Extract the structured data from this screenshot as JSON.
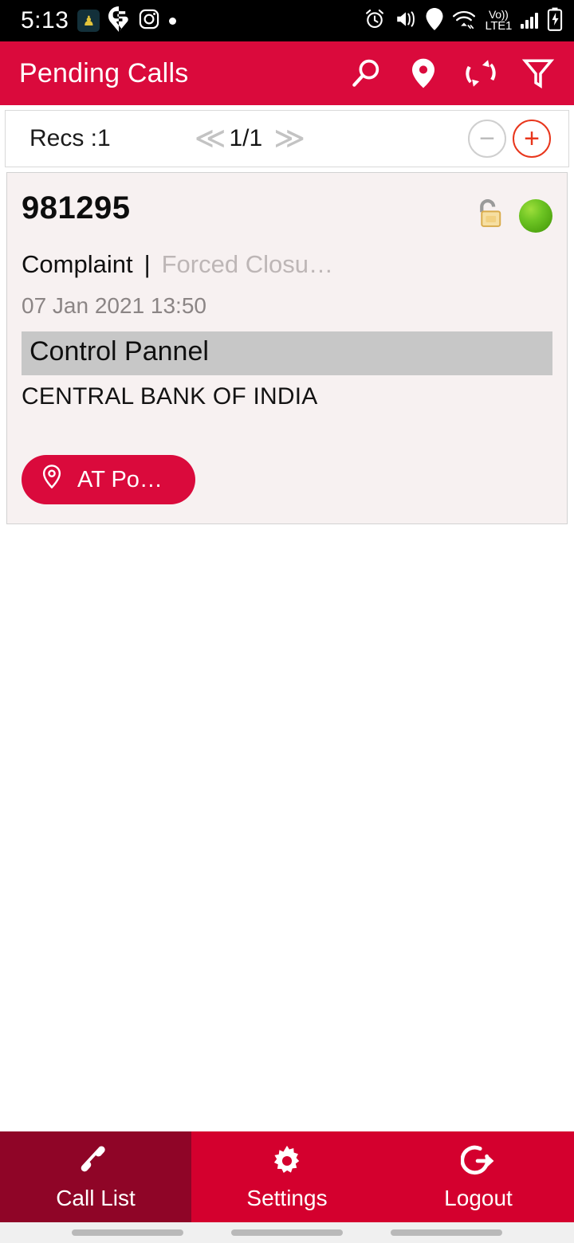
{
  "status_bar": {
    "time": "5:13",
    "left_icons": [
      "app-badge-icon",
      "swiggy-icon",
      "instagram-icon",
      "dot-icon"
    ],
    "right_icons": [
      "alarm-icon",
      "vibrate-icon",
      "location-icon",
      "wifi-icon",
      "signal-icon",
      "battery-charging-icon"
    ],
    "volte_top": "Vo))",
    "volte_bottom": "LTE1"
  },
  "app_bar": {
    "title": "Pending Calls",
    "actions": [
      {
        "name": "search-icon",
        "label": "Search"
      },
      {
        "name": "map-pin-icon",
        "label": "Map"
      },
      {
        "name": "refresh-icon",
        "label": "Refresh"
      },
      {
        "name": "filter-icon",
        "label": "Filter"
      }
    ],
    "background_color": "#DA0A3C"
  },
  "pager": {
    "records_label": "Recs :1",
    "prev_chevron": "≪",
    "page_indicator": "1/1",
    "next_chevron": "≫",
    "minus_label": "−",
    "plus_label": "+",
    "plus_color": "#E8361C",
    "minus_color": "#CFCFCF"
  },
  "call_card": {
    "ticket_number": "981295",
    "lock_state": "unlocked-padlock-icon",
    "status_color": "#6DC423",
    "type": "Complaint",
    "separator": "|",
    "sub_status": "Forced Closu…",
    "datetime": "07 Jan 2021 13:50",
    "highlight_text": "Control Pannel",
    "organisation": "CENTRAL BANK OF INDIA",
    "location_button": "AT Po…"
  },
  "bottom_nav": {
    "items": [
      {
        "label": "Call List",
        "icon": "phone-icon",
        "selected": true
      },
      {
        "label": "Settings",
        "icon": "gear-icon",
        "selected": false
      },
      {
        "label": "Logout",
        "icon": "logout-icon",
        "selected": false
      }
    ],
    "selected_color": "#8F0527",
    "background_color": "#D4002E"
  }
}
